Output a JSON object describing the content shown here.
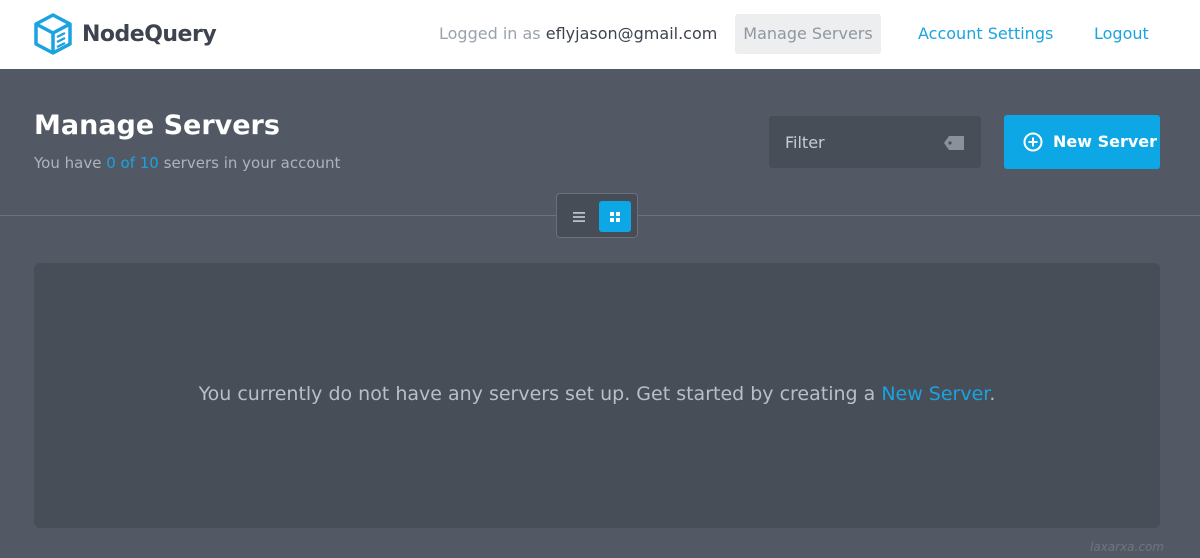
{
  "header": {
    "brand": "NodeQuery",
    "logged_in_prefix": "Logged in as",
    "user_email": "eflyjason@gmail.com",
    "nav": {
      "manage_servers": "Manage Servers",
      "account_settings": "Account Settings",
      "logout": "Logout"
    }
  },
  "main": {
    "title": "Manage Servers",
    "subtitle_prefix": "You have",
    "server_count": "0 of 10",
    "subtitle_suffix": "servers in your account",
    "filter_placeholder": "Filter",
    "new_server_label": "New Server",
    "view_mode": "grid",
    "empty_message": "You currently do not have any servers set up. Get started by creating a",
    "empty_link": "New Server",
    "empty_period": "."
  },
  "watermark": "laxarxa.com",
  "colors": {
    "accent": "#0ea7e6",
    "link": "#1aa3e0",
    "background": "#525964",
    "panel": "#474e58",
    "topbar": "#ffffff"
  },
  "icons": {
    "logo": "cube-logo-icon",
    "filter": "tag-icon",
    "new_server": "plus-circle-icon",
    "list_view": "list-icon",
    "grid_view": "grid-icon"
  }
}
